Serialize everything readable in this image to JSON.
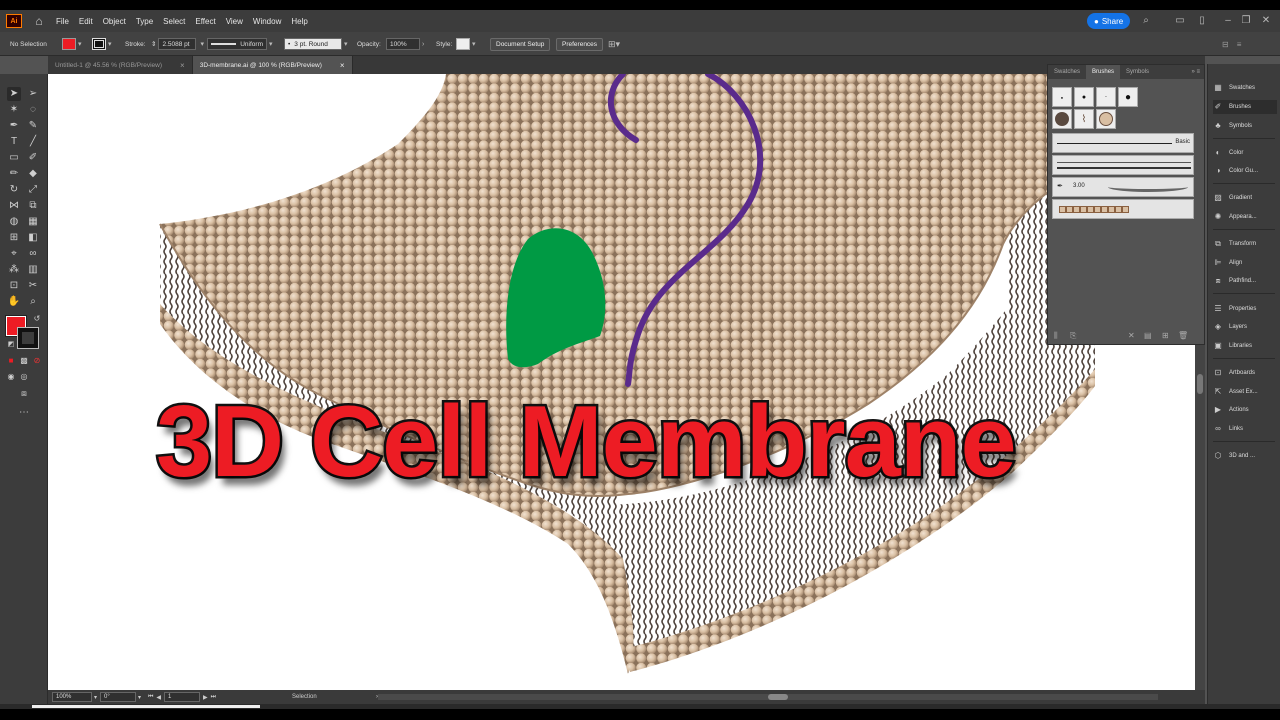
{
  "menubar": {
    "app_logo": "Ai",
    "items": [
      "File",
      "Edit",
      "Object",
      "Type",
      "Select",
      "Effect",
      "View",
      "Window",
      "Help"
    ],
    "share_label": "Share"
  },
  "controlbar": {
    "selection_label": "No Selection",
    "fill_color": "#ed1c24",
    "stroke_label": "Stroke:",
    "stroke_weight": "2.5088 pt",
    "stroke_profile": "Uniform",
    "brush_label": "3 pt. Round",
    "opacity_label": "Opacity:",
    "opacity_value": "100%",
    "style_label": "Style:",
    "document_setup": "Document Setup",
    "preferences": "Preferences"
  },
  "tabs": [
    {
      "label": "Untitled-1 @ 45.56 % (RGB/Preview)"
    },
    {
      "label": "3D-membrane.ai @ 100 % (RGB/Preview)"
    }
  ],
  "canvas": {
    "title_text": "3D Cell Membrane",
    "head_color": "#d9bfa3",
    "tail_color": "#4f433c",
    "protein_color": "#009a44",
    "chain_color": "#5a2b8c"
  },
  "status": {
    "zoom": "100%",
    "rotation": "0°",
    "artboard": "1",
    "tool": "Selection"
  },
  "brushes_panel": {
    "tabs": [
      "Swatches",
      "Brushes",
      "Symbols"
    ],
    "basic_label": "Basic",
    "stroke_value": "3.00"
  },
  "dock": {
    "items": [
      "Swatches",
      "Brushes",
      "Symbols",
      "Color",
      "Color Gu...",
      "Gradient",
      "Appeara...",
      "Transform",
      "Align",
      "Pathfind...",
      "Properties",
      "Layers",
      "Libraries",
      "Artboards",
      "Asset Ex...",
      "Actions",
      "Links",
      "3D and ..."
    ],
    "icons": [
      "grid-icon",
      "brush-icon",
      "club-icon",
      "palette-icon",
      "palette-icon",
      "square-icon",
      "sun-icon",
      "transform-icon",
      "align-icon",
      "pathfinder-icon",
      "sliders-icon",
      "layers-icon",
      "library-icon",
      "artboard-icon",
      "export-icon",
      "play-icon",
      "link-icon",
      "cube-icon"
    ]
  }
}
